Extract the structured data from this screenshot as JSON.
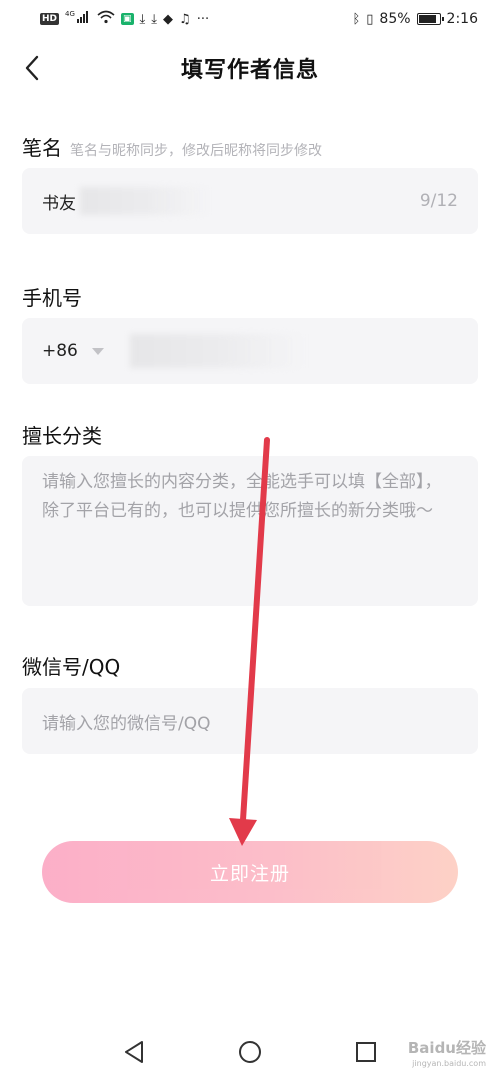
{
  "status_bar": {
    "hd": "HD",
    "network": "4G",
    "battery_percent": "85%",
    "time": "2:16",
    "dots": "···"
  },
  "nav": {
    "title": "填写作者信息"
  },
  "pen_name": {
    "label": "笔名",
    "hint": "笔名与昵称同步，修改后昵称将同步修改",
    "value": "书友",
    "counter": "9/12"
  },
  "phone": {
    "label": "手机号",
    "country_code": "+86"
  },
  "category": {
    "label": "擅长分类",
    "placeholder": "请输入您擅长的内容分类，全能选手可以填【全部】，除了平台已有的，也可以提供您所擅长的新分类哦～"
  },
  "wechat": {
    "label": "微信号/QQ",
    "placeholder": "请输入您的微信号/QQ"
  },
  "register_button": {
    "label": "立即注册"
  },
  "colors": {
    "button_start": "#fba6c2",
    "button_end": "#fdccc0",
    "field_bg": "#f5f5f7",
    "arrow": "#e23a4a"
  },
  "watermark": {
    "brand": "Baidu经验",
    "url": "jingyan.baidu.com"
  }
}
